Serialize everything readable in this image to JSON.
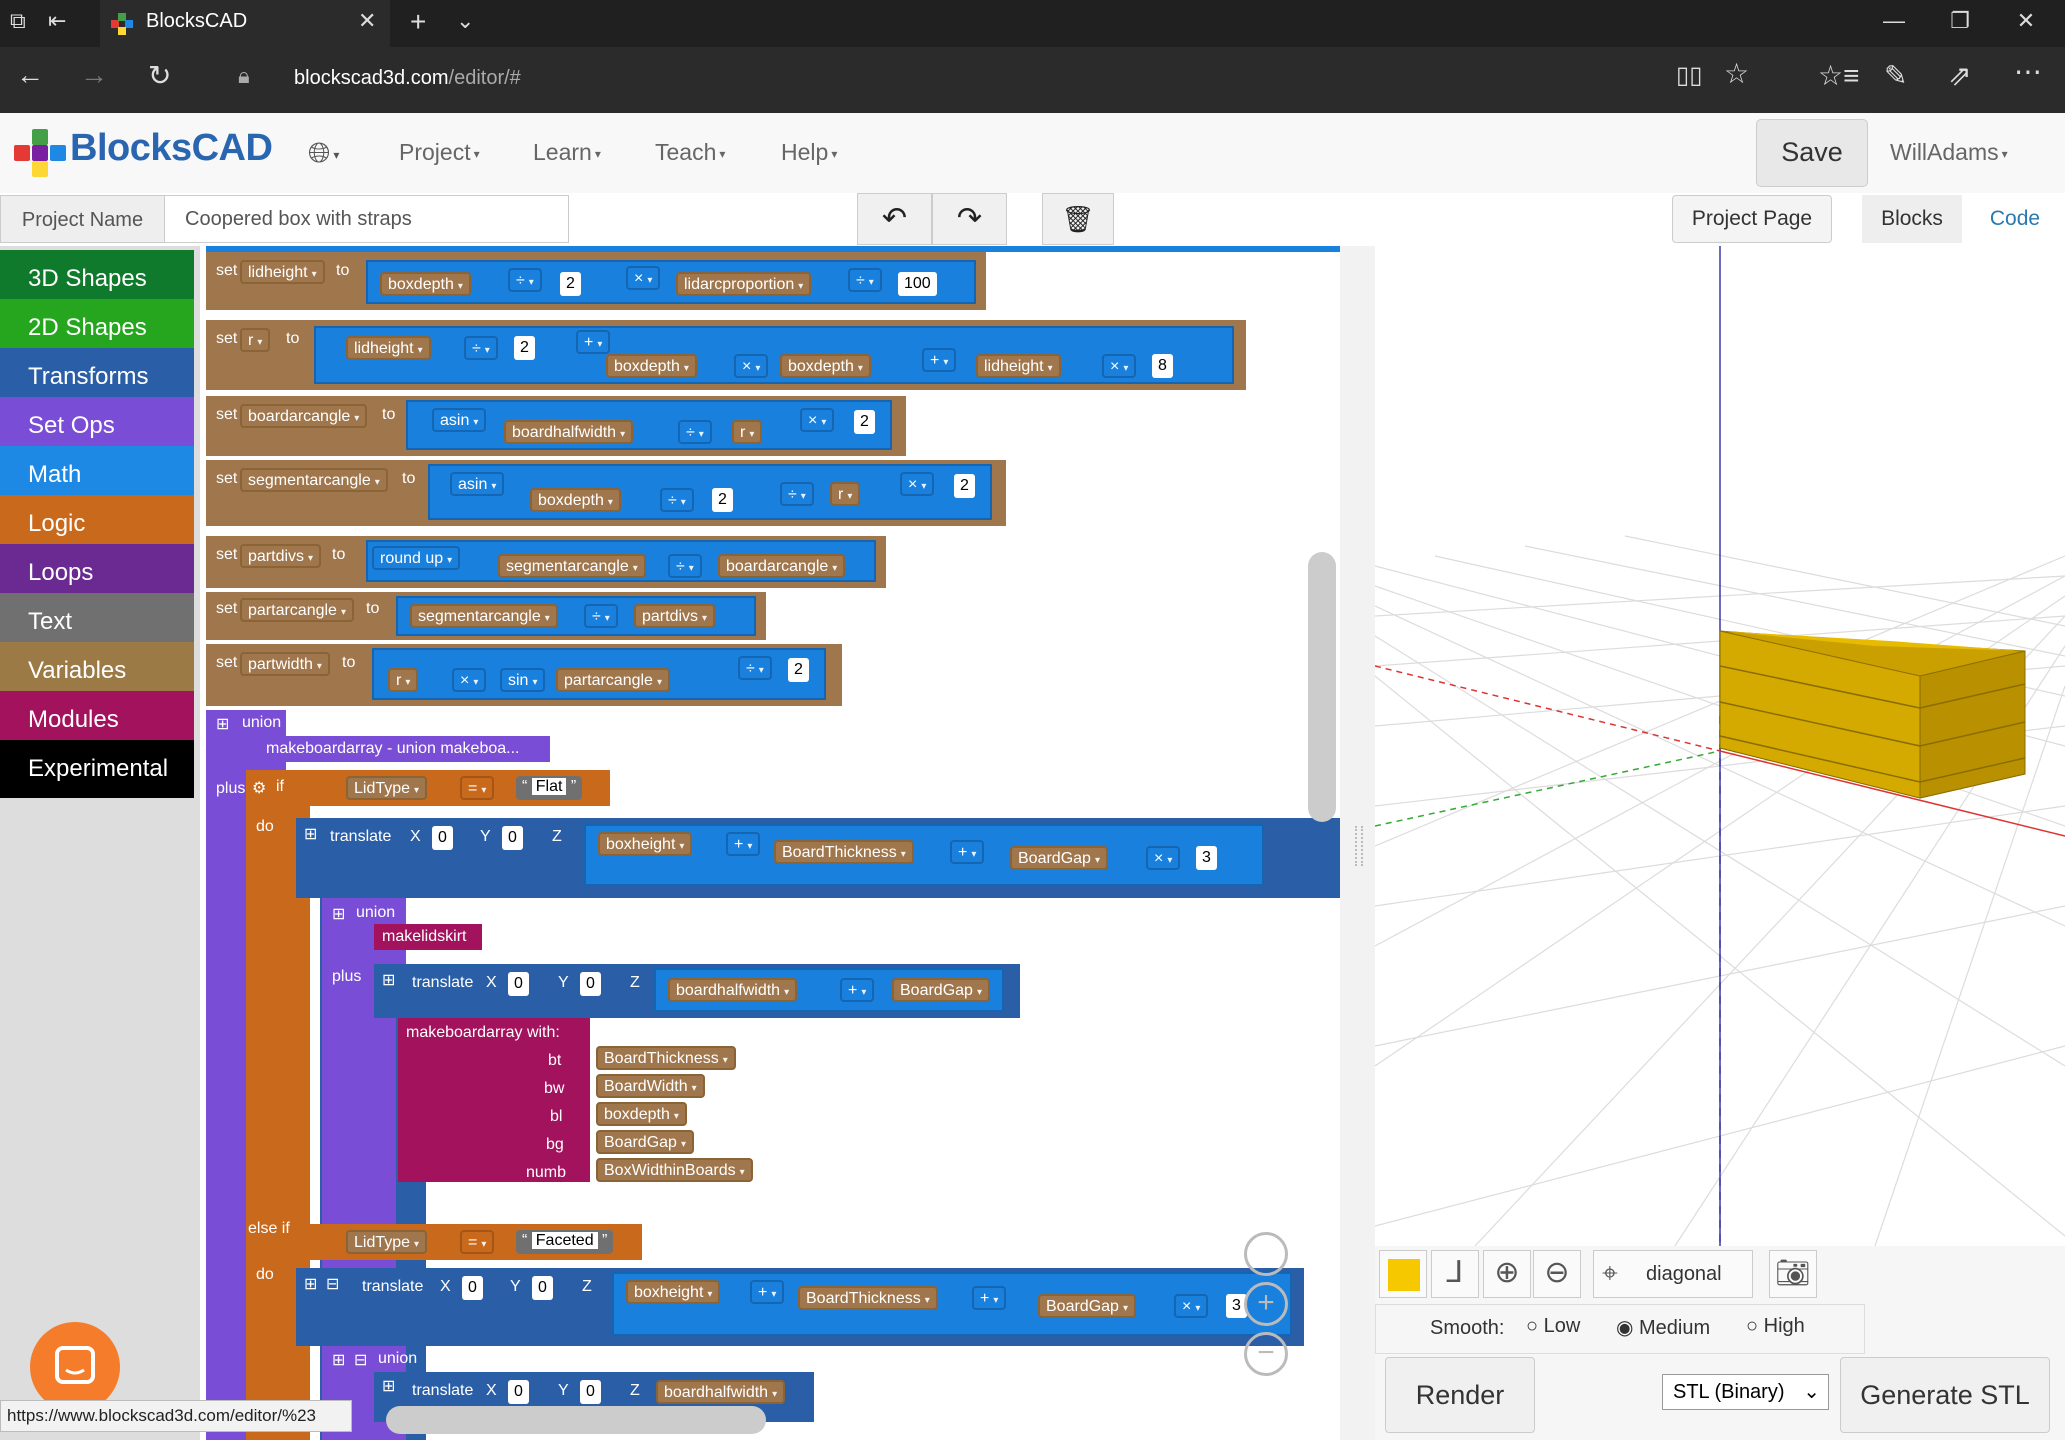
{
  "browser": {
    "tab_title": "BlocksCAD",
    "url_host": "blockscad3d.com",
    "url_path": "/editor/#",
    "status_url": "https://www.blockscad3d.com/editor/%23"
  },
  "app": {
    "logo_text": "BlocksCAD",
    "menu": [
      "Project",
      "Learn",
      "Teach",
      "Help"
    ],
    "save_label": "Save",
    "user": "WillAdams"
  },
  "project": {
    "name_label": "Project Name",
    "name_value": "Coopered box with straps",
    "project_page_label": "Project Page",
    "tab_blocks": "Blocks",
    "tab_code": "Code"
  },
  "toolbox": [
    {
      "label": "3D Shapes",
      "color": "#0f7a2c"
    },
    {
      "label": "2D Shapes",
      "color": "#26a61e"
    },
    {
      "label": "Transforms",
      "color": "#2a5fa8"
    },
    {
      "label": "Set Ops",
      "color": "#7a4dd6"
    },
    {
      "label": "Math",
      "color": "#1e88e5"
    },
    {
      "label": "Logic",
      "color": "#c8691c"
    },
    {
      "label": "Loops",
      "color": "#6a2a91"
    },
    {
      "label": "Text",
      "color": "#707070"
    },
    {
      "label": "Variables",
      "color": "#9c7a45"
    },
    {
      "label": "Modules",
      "color": "#a3125d"
    },
    {
      "label": "Experimental",
      "color": "#000000"
    }
  ],
  "blocks": {
    "set_word": "set",
    "to_word": "to",
    "vars": {
      "lidheight": "lidheight",
      "r": "r",
      "boardarcangle": "boardarcangle",
      "segmentarcangle": "segmentarcangle",
      "partdivs": "partdivs",
      "partarcangle": "partarcangle",
      "partwidth": "partwidth",
      "boxdepth": "boxdepth",
      "lidarcproportion": "lidarcproportion",
      "boardhalfwidth": "boardhalfwidth",
      "boxheight": "boxheight",
      "BoardThickness": "BoardThickness",
      "BoardGap": "BoardGap",
      "BoardWidth": "BoardWidth",
      "BoxWidthinBoards": "BoxWidthinBoards",
      "LidType": "LidType"
    },
    "ops": {
      "div": "÷",
      "mul": "×",
      "plus": "+",
      "eq": "="
    },
    "numbers": {
      "n2": "2",
      "n100": "100",
      "n8": "8",
      "n3": "3",
      "n0": "0"
    },
    "funcs": {
      "asin": "asin",
      "roundup": "round up",
      "sin": "sin"
    },
    "union": "union",
    "plus_word": "plus",
    "makeboardarray_call": "makeboardarray - union makeboa...",
    "if_word": "if",
    "do_word": "do",
    "else_if_word": "else if",
    "translate": "translate",
    "X": "X",
    "Y": "Y",
    "Z": "Z",
    "flat": "Flat",
    "faceted": "Faceted",
    "makelidskirt": "makelidskirt",
    "makeboardarray_with": "makeboardarray  with:",
    "params": [
      "bt",
      "bw",
      "bl",
      "bg",
      "numb"
    ]
  },
  "viewer": {
    "view_name": "diagonal",
    "smooth_label": "Smooth:",
    "smooth_options": [
      "Low",
      "Medium",
      "High"
    ],
    "smooth_selected": "Medium",
    "render_label": "Render",
    "format": "STL (Binary)",
    "generate_label": "Generate STL",
    "part_color": "#f5c800"
  }
}
